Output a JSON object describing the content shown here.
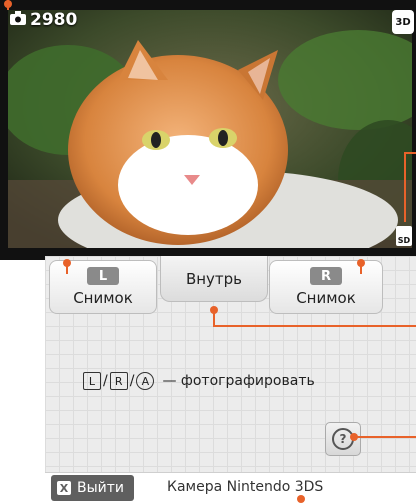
{
  "top_screen": {
    "photo_counter": "2980",
    "camera_icon": "camera-icon",
    "badge_3d": "3D",
    "badge_sd": "SD"
  },
  "tabs": {
    "left": {
      "key": "L",
      "label": "Снимок"
    },
    "center": {
      "label": "Внутрь"
    },
    "right": {
      "key": "R",
      "label": "Снимок"
    }
  },
  "hint": {
    "keys": [
      "L",
      "R",
      "A"
    ],
    "text": "— фотографировать"
  },
  "help_button": {
    "icon": "help-icon",
    "glyph": "?"
  },
  "footer": {
    "exit_key": "X",
    "exit_label": "Выйти",
    "app_name": "Камера Nintendo 3DS"
  },
  "colors": {
    "callout": "#e8622a",
    "grid_bg": "#ececec",
    "exit_bg": "#5f5f5f"
  }
}
